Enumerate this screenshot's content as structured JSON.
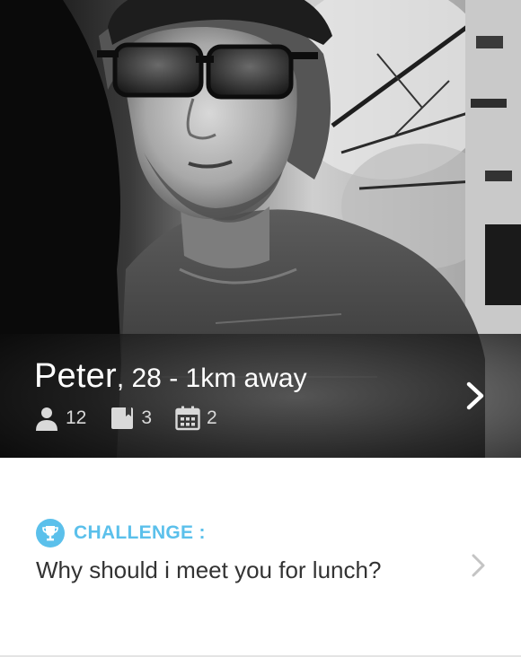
{
  "profile": {
    "name": "Peter",
    "details": ", 28 - 1km away",
    "stats": {
      "friends": "12",
      "books": "3",
      "events": "2"
    }
  },
  "challenge": {
    "label": "CHALLENGE :",
    "question": "Why should i meet you for lunch?"
  },
  "colors": {
    "accent": "#5bc0eb",
    "question_text": "#333333"
  },
  "icons": {
    "friends": "person-icon",
    "books": "book-icon",
    "events": "calendar-icon",
    "challenge": "trophy-icon",
    "next": "chevron-right-icon"
  }
}
